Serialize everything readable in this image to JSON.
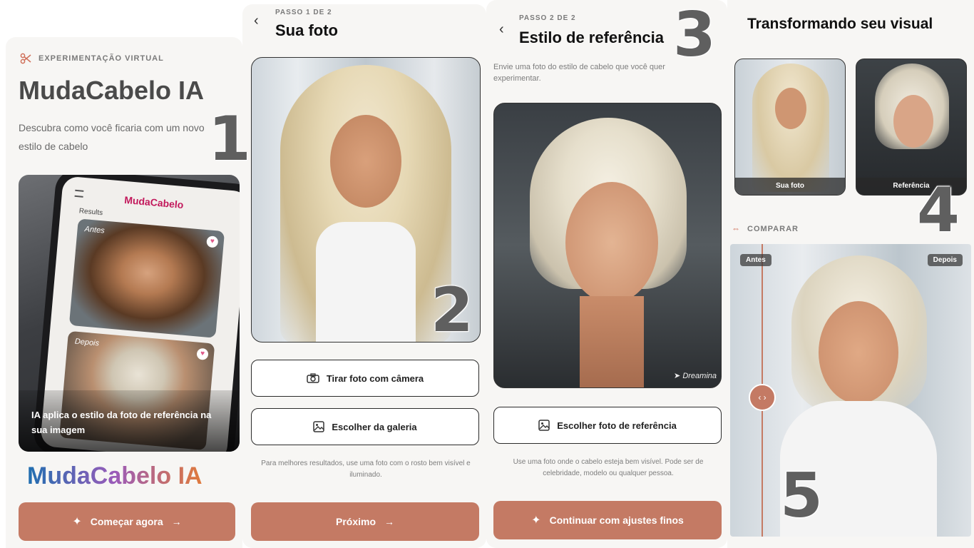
{
  "overlay_numbers": [
    "1",
    "2",
    "3",
    "4",
    "5"
  ],
  "brand_gradient": [
    "#1f6fb0",
    "#9b5bb9",
    "#e07a3a"
  ],
  "accent": "#c47a64",
  "panel1": {
    "eyebrow": "EXPERIMENTAÇÃO VIRTUAL",
    "eyebrow_icon": "scissors-icon",
    "title": "MudaCabelo IA",
    "subtitle_line1": "Descubra como você ficaria com um novo",
    "subtitle_line2": "estilo de cabelo",
    "phone": {
      "logo": "MudaCabelo",
      "results_label": "Results",
      "before_label": "Antes",
      "after_label": "Depois"
    },
    "caption": "IA aplica o estilo da foto de referência na sua imagem",
    "brand_text": "MudaCabelo IA",
    "cta": "Começar agora"
  },
  "panel2": {
    "step": "PASSO 1 DE 2",
    "title": "Sua foto",
    "camera_button": "Tirar foto com câmera",
    "gallery_button": "Escolher da galeria",
    "hint": "Para melhores resultados, use uma foto com o rosto bem visível e iluminado.",
    "next_button": "Próximo"
  },
  "panel3": {
    "step": "PASSO 2 DE 2",
    "title": "Estilo de referência",
    "description": "Envie uma foto do estilo de cabelo que você quer experimentar.",
    "watermark": "Dreamina",
    "choose_button": "Escolher foto de referência",
    "hint": "Use uma foto onde o cabelo esteja bem visível. Pode ser de celebridade, modelo ou qualquer pessoa.",
    "continue_button": "Continuar com ajustes finos"
  },
  "panel4": {
    "title": "Transformando seu visual",
    "thumb_yours": "Sua foto",
    "thumb_reference": "Referência",
    "compare_label": "COMPARAR",
    "before_tag": "Antes",
    "after_tag": "Depois"
  }
}
